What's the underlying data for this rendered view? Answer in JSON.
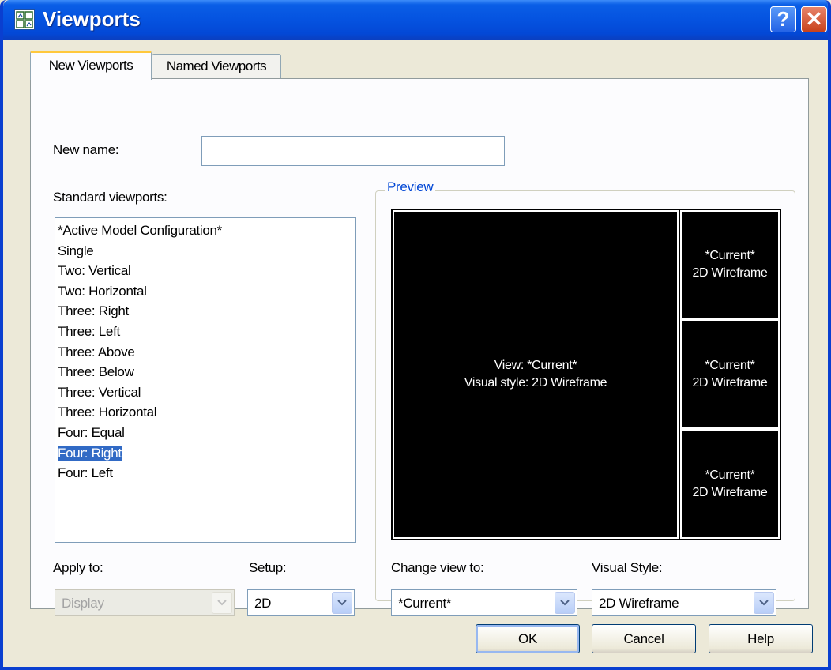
{
  "window": {
    "title": "Viewports"
  },
  "tabs": [
    {
      "label": "New Viewports",
      "active": true
    },
    {
      "label": "Named Viewports",
      "active": false
    }
  ],
  "new_name": {
    "label": "New name:",
    "value": ""
  },
  "standard_viewports": {
    "label": "Standard viewports:",
    "items": [
      "*Active Model Configuration*",
      "Single",
      "Two: Vertical",
      "Two: Horizontal",
      "Three: Right",
      "Three: Left",
      "Three: Above",
      "Three: Below",
      "Three: Vertical",
      "Three: Horizontal",
      "Four: Equal",
      "Four: Right",
      "Four: Left"
    ],
    "selected": "Four: Right"
  },
  "preview": {
    "label": "Preview",
    "main": {
      "line1": "View: *Current*",
      "line2": "Visual style: 2D Wireframe"
    },
    "side": [
      {
        "line1": "*Current*",
        "line2": "2D Wireframe"
      },
      {
        "line1": "*Current*",
        "line2": "2D Wireframe"
      },
      {
        "line1": "*Current*",
        "line2": "2D Wireframe"
      }
    ]
  },
  "apply_to": {
    "label": "Apply to:",
    "value": "Display",
    "disabled": true
  },
  "setup": {
    "label": "Setup:",
    "value": "2D"
  },
  "change_view_to": {
    "label": "Change view to:",
    "value": "*Current*"
  },
  "visual_style": {
    "label": "Visual Style:",
    "value": "2D Wireframe"
  },
  "buttons": {
    "ok": "OK",
    "cancel": "Cancel",
    "help": "Help"
  },
  "colors": {
    "titlebar": "#0553e0",
    "selection": "#316ac5",
    "groupbox_title": "#0046d5"
  }
}
